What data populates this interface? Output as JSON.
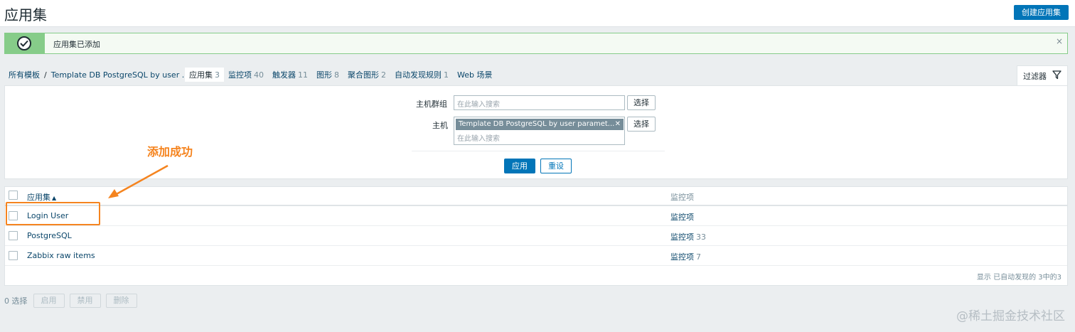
{
  "header": {
    "title": "应用集",
    "create_button": "创建应用集"
  },
  "message": {
    "text": "应用集已添加",
    "close": "×"
  },
  "breadcrumbs": {
    "all_templates": "所有模板",
    "separator": "/",
    "template": "Template DB PostgreSQL by user ..."
  },
  "tabs": [
    {
      "label": "应用集",
      "count": "3"
    },
    {
      "label": "监控项",
      "count": "40"
    },
    {
      "label": "触发器",
      "count": "11"
    },
    {
      "label": "图形",
      "count": "8"
    },
    {
      "label": "聚合图形",
      "count": "2"
    },
    {
      "label": "自动发现规则",
      "count": "1"
    },
    {
      "label": "Web 场景",
      "count": ""
    }
  ],
  "filter": {
    "tab_label": "过滤器",
    "host_group_label": "主机群组",
    "host_group_placeholder": "在此输入搜索",
    "host_label": "主机",
    "host_tag": "Template DB PostgreSQL by user paramet...",
    "host_placeholder": "在此输入搜索",
    "select_button": "选择",
    "apply_button": "应用",
    "reset_button": "重设"
  },
  "annotation": {
    "text": "添加成功",
    "color": "#f5841f"
  },
  "table": {
    "col_name": "应用集",
    "col_items": "监控项",
    "rows": [
      {
        "name": "Login User",
        "items_label": "监控项",
        "items_count": ""
      },
      {
        "name": "PostgreSQL",
        "items_label": "监控项",
        "items_count": "33"
      },
      {
        "name": "Zabbix raw items",
        "items_label": "监控项",
        "items_count": "7"
      }
    ],
    "footer": "显示 已自动发现的 3中的3"
  },
  "bottom": {
    "selected": "0 选择",
    "enable": "启用",
    "disable": "禁用",
    "delete": "删除"
  },
  "watermark": "@稀土掘金技术社区",
  "colors": {
    "primary": "#0275b8",
    "success": "#86cc89",
    "link": "#0a466a",
    "accent": "#f5841f"
  }
}
